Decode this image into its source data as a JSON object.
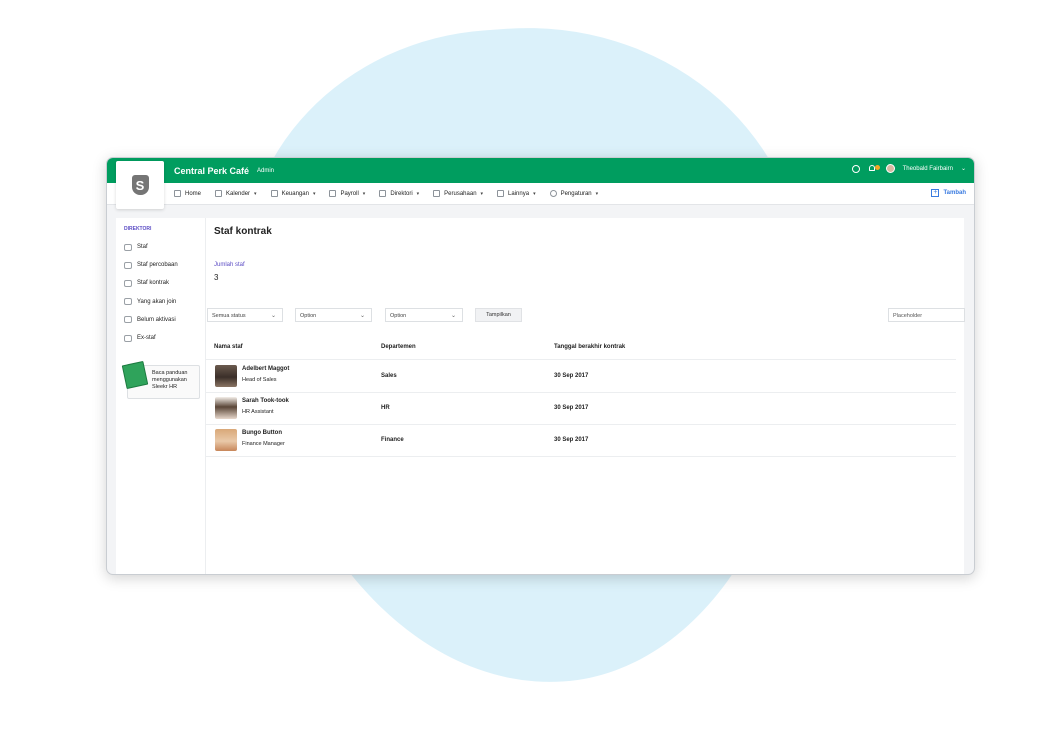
{
  "app": {
    "company": "Central Perk Café",
    "role": "Admin",
    "user_name": "Theobald Fairbairn",
    "logo_letter": "S"
  },
  "nav": {
    "items": [
      {
        "label": "Home",
        "caret": ""
      },
      {
        "label": "Kalender",
        "caret": "▾"
      },
      {
        "label": "Keuangan",
        "caret": "▾"
      },
      {
        "label": "Payroll",
        "caret": "▾"
      },
      {
        "label": "Direktori",
        "caret": "▾"
      },
      {
        "label": "Perusahaan",
        "caret": "▾"
      },
      {
        "label": "Lainnya",
        "caret": "▾"
      },
      {
        "label": "Pengaturan",
        "caret": "▾"
      }
    ],
    "add_label": "Tambah"
  },
  "sidebar": {
    "heading": "DIREKTORI",
    "items": [
      {
        "label": "Staf"
      },
      {
        "label": "Staf percobaan"
      },
      {
        "label": "Staf kontrak"
      },
      {
        "label": "Yang akan join"
      },
      {
        "label": "Belum aktivasi"
      },
      {
        "label": "Ex-staf"
      }
    ],
    "guide": "Baca panduan menggunakan Sleekr HR"
  },
  "main": {
    "title": "Staf kontrak",
    "count_label": "Jumlah staf",
    "count_value": "3",
    "filters": {
      "status": "Semua status",
      "option1": "Option",
      "option2": "Option",
      "show_button": "Tampilkan",
      "search_placeholder": "Placeholder"
    },
    "columns": [
      "Nama staf",
      "Departemen",
      "Tanggal berakhir kontrak"
    ],
    "rows": [
      {
        "name": "Adelbert Maggot",
        "title": "Head of Sales",
        "dept": "Sales",
        "date": "30 Sep 2017"
      },
      {
        "name": "Sarah Took-took",
        "title": "HR Assistant",
        "dept": "HR",
        "date": "30 Sep 2017"
      },
      {
        "name": "Bungo Button",
        "title": "Finance Manager",
        "dept": "Finance",
        "date": "30 Sep 2017"
      }
    ]
  },
  "colors": {
    "brand_green": "#009d5f",
    "accent_purple": "#5b4cc4",
    "link_blue": "#3a7be0",
    "background_blob": "#dbf1fa"
  }
}
